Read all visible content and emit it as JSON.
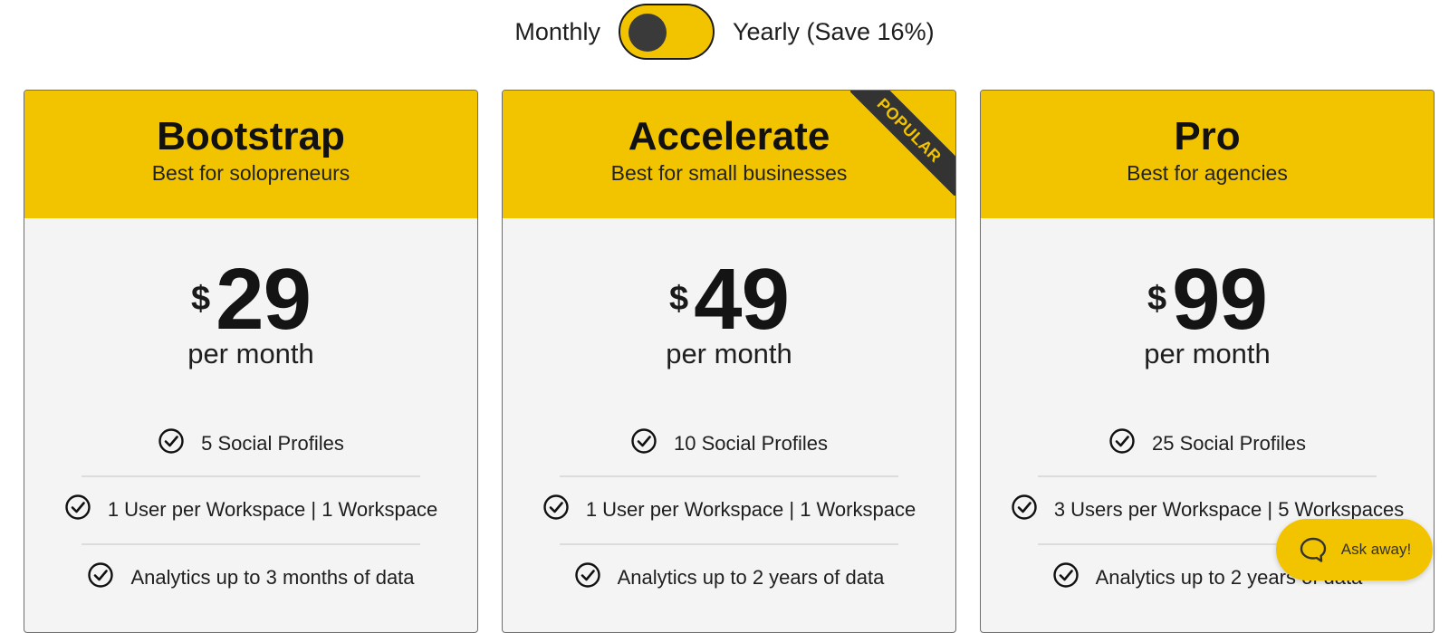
{
  "billing": {
    "monthly_label": "Monthly",
    "yearly_label": "Yearly (Save 16%)"
  },
  "plans": [
    {
      "name": "Bootstrap",
      "subtitle": "Best for solopreneurs",
      "currency": "$",
      "price": "29",
      "period": "per month",
      "features": [
        "5 Social Profiles",
        "1 User per Workspace | 1 Workspace",
        "Analytics up to 3 months of data"
      ]
    },
    {
      "name": "Accelerate",
      "subtitle": "Best for small businesses",
      "badge": "POPULAR",
      "currency": "$",
      "price": "49",
      "period": "per month",
      "features": [
        "10 Social Profiles",
        "1 User per Workspace | 1 Workspace",
        "Analytics up to 2 years of data"
      ]
    },
    {
      "name": "Pro",
      "subtitle": "Best for agencies",
      "currency": "$",
      "price": "99",
      "period": "per month",
      "features": [
        "25 Social Profiles",
        "3 Users per Workspace | 5 Workspaces",
        "Analytics up to 2 years of data"
      ]
    }
  ],
  "chat": {
    "label": "Ask away!",
    "icon": "chat-bubble-icon"
  },
  "colors": {
    "accent": "#f2c400",
    "dark": "#333333",
    "card_bg": "#f4f4f4"
  },
  "icons": {
    "feature": "check-circle-icon"
  }
}
